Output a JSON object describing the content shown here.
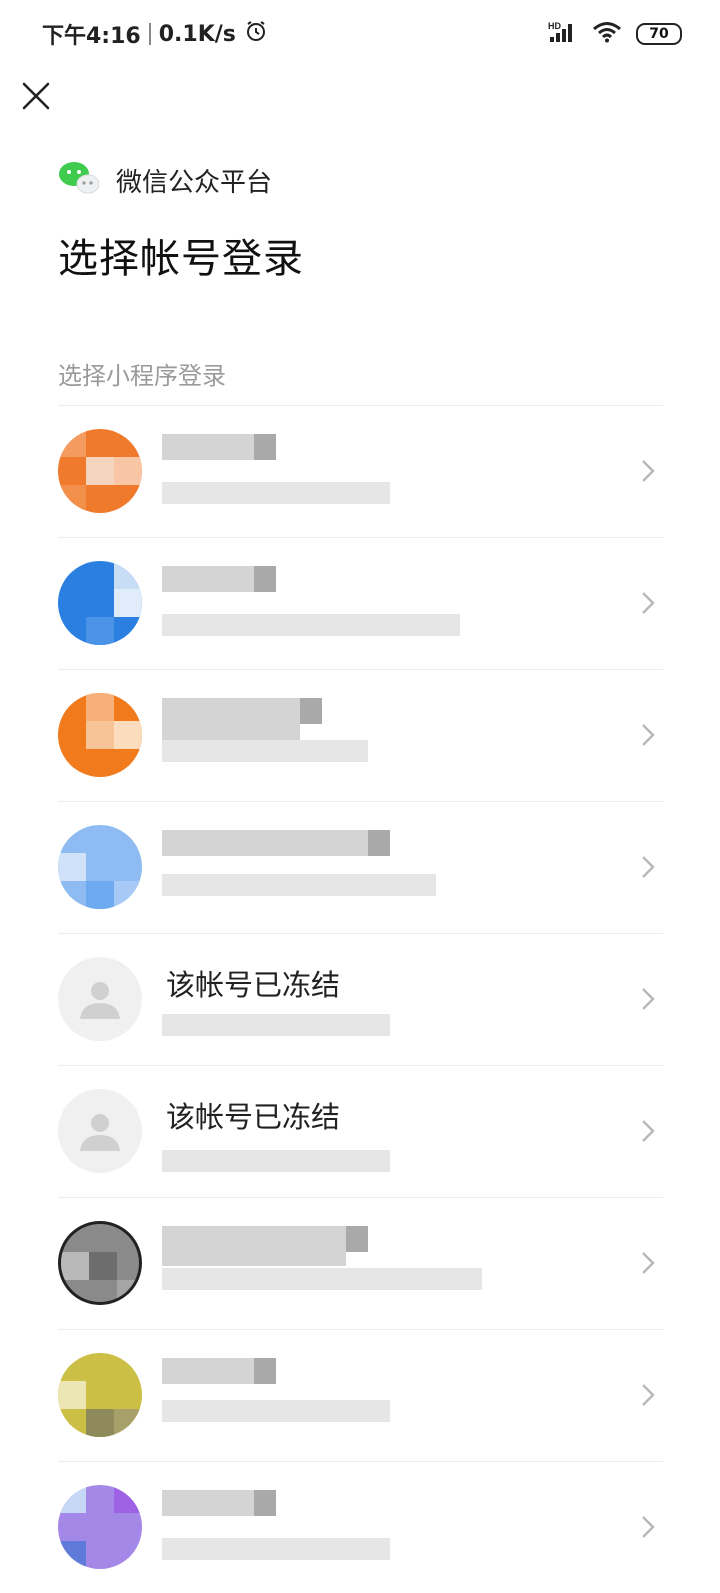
{
  "status_bar": {
    "time": "下午4:16",
    "speed": "0.1K/s",
    "network": "HD",
    "battery": "70"
  },
  "header": {
    "brand": "微信公众平台",
    "title": "选择帐号登录",
    "section_label": "选择小程序登录"
  },
  "accounts": [
    {
      "avatar_color": "#f07a2c",
      "name": "",
      "frozen": false
    },
    {
      "avatar_color": "#2a7fe0",
      "name": "",
      "frozen": false
    },
    {
      "avatar_color": "#f59336",
      "name": "",
      "frozen": false
    },
    {
      "avatar_color": "#6eaaf0",
      "name": "",
      "frozen": false
    },
    {
      "avatar_color": "#f0f0f0",
      "name": "该帐号已冻结",
      "frozen": true
    },
    {
      "avatar_color": "#f0f0f0",
      "name": "该帐号已冻结",
      "frozen": true
    },
    {
      "avatar_color": "#7b7b7b",
      "name": "",
      "frozen": false
    },
    {
      "avatar_color": "#cbbf45",
      "name": "",
      "frozen": false
    },
    {
      "avatar_color": "#a488e8",
      "name": "",
      "frozen": false
    }
  ],
  "colors": {
    "wechat_green": "#3fcb4e",
    "divider": "#ececec",
    "chevron": "#b7b7b7",
    "section_label": "#9a9a9a"
  }
}
